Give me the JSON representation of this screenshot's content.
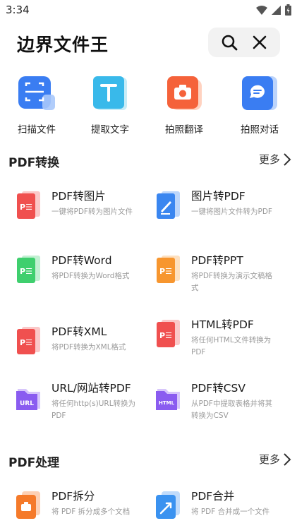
{
  "status_bar": {
    "time": "3:34"
  },
  "header": {
    "title": "边界文件王"
  },
  "quick_actions": [
    {
      "label": "扫描文件",
      "icon": "scan-icon"
    },
    {
      "label": "提取文字",
      "icon": "text-extract-icon"
    },
    {
      "label": "拍照翻译",
      "icon": "camera-icon"
    },
    {
      "label": "拍照对话",
      "icon": "chat-icon"
    }
  ],
  "sections": {
    "convert": {
      "title": "PDF转换",
      "more": "更多"
    },
    "process": {
      "title": "PDF处理",
      "more": "更多"
    }
  },
  "convert_tools": [
    {
      "title": "PDF转图片",
      "desc": "一键将PDF转为图片文件",
      "icon": "pdf-to-image-icon"
    },
    {
      "title": "图片转PDF",
      "desc": "一键将图片文件转为PDF",
      "icon": "image-to-pdf-icon"
    },
    {
      "title": "PDF转Word",
      "desc": "将PDF转换为Word格式",
      "icon": "pdf-to-word-icon"
    },
    {
      "title": "PDF转PPT",
      "desc": "将PDF转换为演示文稿格式",
      "icon": "pdf-to-ppt-icon"
    },
    {
      "title": "PDF转XML",
      "desc": "将PDF转换为XML格式",
      "icon": "pdf-to-xml-icon"
    },
    {
      "title": "HTML转PDF",
      "desc": "将任何HTML文件转换为PDF",
      "icon": "html-to-pdf-icon"
    },
    {
      "title": "URL/网站转PDF",
      "desc": "将任何http(s)URL转换为PDF",
      "icon": "url-to-pdf-icon"
    },
    {
      "title": "PDF转CSV",
      "desc": "从PDF中提取表格并将其转换为CSV",
      "icon": "pdf-to-csv-icon"
    }
  ],
  "process_tools": [
    {
      "title": "PDF拆分",
      "desc": "将 PDF 拆分成多个文档",
      "icon": "pdf-split-icon"
    },
    {
      "title": "PDF合并",
      "desc": "将 PDF 合并成一个文件",
      "icon": "pdf-merge-icon"
    }
  ],
  "colors": {
    "pdf_red": "#f0504f",
    "word_green": "#3fcf6e",
    "ppt_orange": "#f7962f",
    "image_blue": "#3a86f0",
    "url_purple": "#8a5cf0",
    "split_orange": "#f57a2a",
    "merge_blue": "#3a92f0"
  }
}
